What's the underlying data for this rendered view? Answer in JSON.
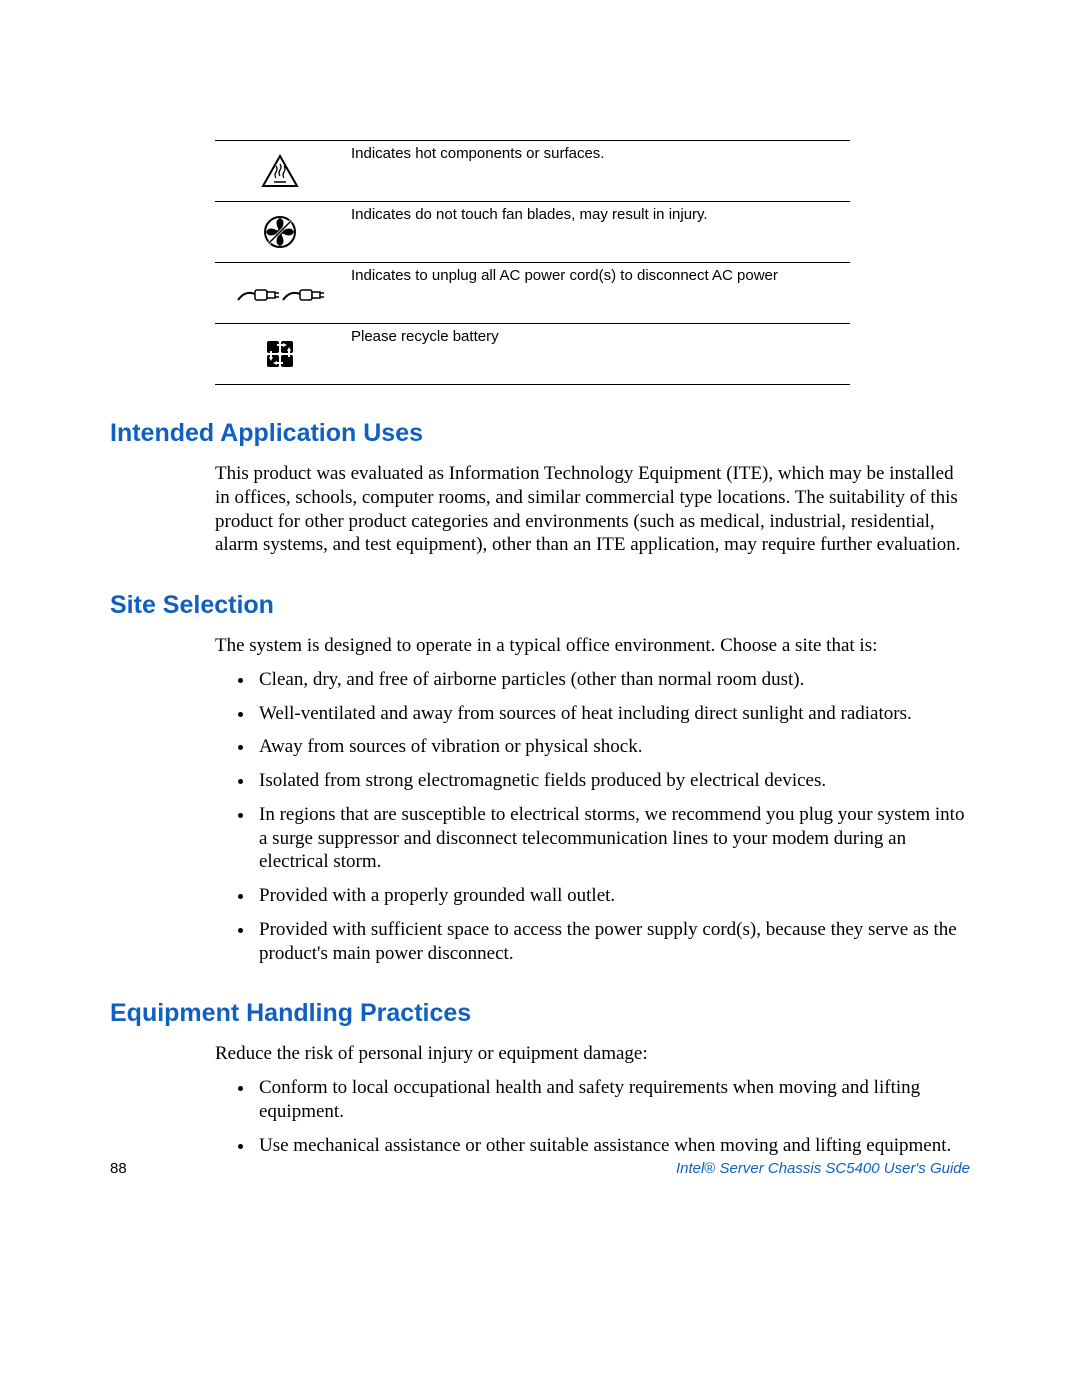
{
  "symbols": [
    {
      "desc": "Indicates hot components or surfaces."
    },
    {
      "desc": "Indicates do not touch fan blades, may result in injury."
    },
    {
      "desc": "Indicates to unplug all AC power cord(s) to disconnect AC power"
    },
    {
      "desc": "Please recycle battery"
    }
  ],
  "sections": {
    "intended": {
      "heading": "Intended Application Uses",
      "para": "This product was evaluated as Information Technology Equipment (ITE), which may be installed in offices, schools, computer rooms, and similar commercial type locations. The suitability of this product for other product categories and environments (such as medical, industrial, residential, alarm systems, and test equipment), other than an ITE application, may require further evaluation."
    },
    "site": {
      "heading": "Site Selection",
      "para": "The system is designed to operate in a typical office environment. Choose a site that is:",
      "items": [
        "Clean, dry, and free of airborne particles (other than normal room dust).",
        "Well-ventilated and away from sources of heat including direct sunlight and radiators.",
        "Away from sources of vibration or physical shock.",
        "Isolated from strong electromagnetic fields produced by electrical devices.",
        "In regions that are susceptible to electrical storms, we recommend you plug your system into a surge suppressor and disconnect telecommunication lines to your modem during an electrical storm.",
        "Provided with a properly grounded wall outlet.",
        "Provided with sufficient space to access the power supply cord(s), because they serve as the product's main power disconnect."
      ]
    },
    "equip": {
      "heading": "Equipment Handling Practices",
      "para": "Reduce the risk of personal injury or equipment damage:",
      "items": [
        "Conform to local occupational health and safety requirements when moving and lifting equipment.",
        "Use mechanical assistance or other suitable assistance when moving and lifting equipment."
      ]
    }
  },
  "footer": {
    "page": "88",
    "brand": "Intel",
    "reg": "®",
    "title_rest": " Server Chassis SC5400 User's Guide"
  }
}
